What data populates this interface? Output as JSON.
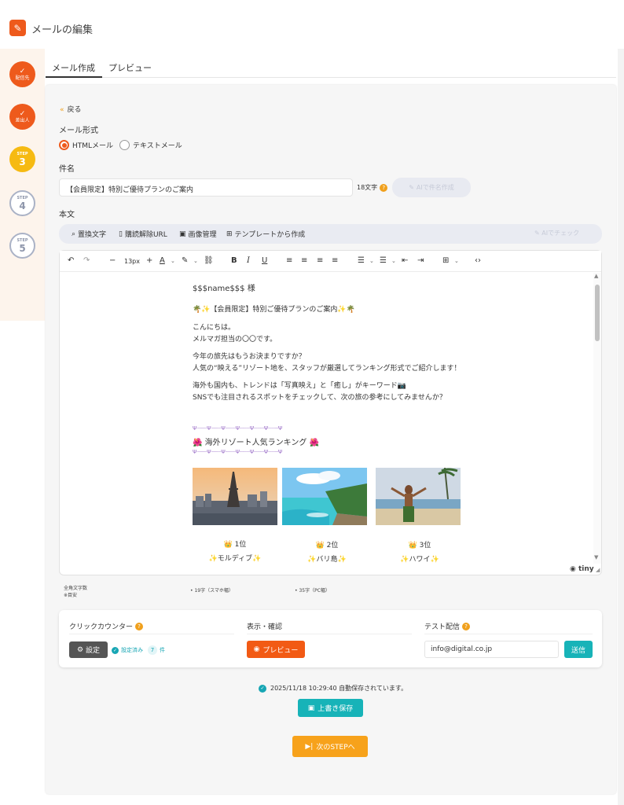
{
  "header": {
    "title": "メールの編集",
    "icon": "pencil-icon"
  },
  "steps": [
    {
      "label": "配信先",
      "state": "done"
    },
    {
      "label": "差出人",
      "state": "done"
    },
    {
      "label": "STEP",
      "num": "3",
      "state": "current"
    },
    {
      "label": "STEP",
      "num": "4",
      "state": "todo"
    },
    {
      "label": "STEP",
      "num": "5",
      "state": "todo"
    }
  ],
  "tabs": [
    {
      "label": "メール作成",
      "active": true
    },
    {
      "label": "プレビュー",
      "active": false
    }
  ],
  "form": {
    "back": "戻る",
    "format_label": "メール形式",
    "format_html": "HTMLメール",
    "format_text": "テキストメール",
    "subject_label": "件名",
    "subject_value": "【会員限定】特別ご優待プランのご案内",
    "char_count": "18文字",
    "ai_subject": "AIで件名作成",
    "body_label": "本文"
  },
  "insert_toolbar": {
    "replace": "置換文字",
    "unsubscribe": "購読解除URL",
    "image": "画像管理",
    "template": "テンプレートから作成",
    "ai_check": "AIでチェック"
  },
  "editor_toolbar": {
    "font_size": "13px"
  },
  "email_body": {
    "greeting": "$$$name$$$ 様",
    "headline": "🌴✨【会員限定】特別ご優待プランのご案内✨🌴",
    "p1_l1": "こんにちは。",
    "p1_l2": "メルマガ担当の〇〇です。",
    "p2_l1": "今年の旅先はもうお決まりですか？",
    "p2_l2": "人気の“映える”リゾート地を、スタッフが厳選してランキング形式でご紹介します！",
    "p3_l1": "海外も国内も、トレンドは「写真映え」と「癒し」がキーワード📷",
    "p3_l2": "SNSでも注目されるスポットをチェックして、次の旅の参考にしてみませんか？",
    "deco_line": "Ψ┈┈┈Ψ┈┈┈Ψ┈┈┈Ψ┈┈┈Ψ┈┈┈Ψ┈┈┈Ψ",
    "ranking_title": "🌺 海外リゾート人気ランキング 🌺",
    "rankings": [
      {
        "rank": "👑 1位",
        "place": "✨モルディブ✨"
      },
      {
        "rank": "👑 2位",
        "place": "✨バリ島✨"
      },
      {
        "rank": "👑 3位",
        "place": "✨ハワイ✨"
      }
    ],
    "tiny_logo": "tiny"
  },
  "meta": {
    "count_label_l1": "全角文字数",
    "count_label_l2": "※目安",
    "smartphone": "19字（スマホ幅）",
    "pc": "35字（PC幅）"
  },
  "settings_card": {
    "click_counter": "クリックカウンター",
    "settings_btn": "設定",
    "status": "設定済み",
    "count": "7",
    "count_unit": "件",
    "display_check": "表示・確認",
    "preview_btn": "プレビュー",
    "test_send": "テスト配信",
    "test_email": "info@digital.co.jp",
    "send_btn": "送信"
  },
  "footer": {
    "autosave_time": "2025/11/18 10:29:40",
    "autosave_msg": "自動保存されています。",
    "save_btn": "上書き保存",
    "next_btn": "次のSTEPへ"
  },
  "colors": {
    "accent": "#ee5a1c",
    "step_current": "#f6ba12",
    "teal": "#17b3b8",
    "next": "#f7a21b"
  }
}
